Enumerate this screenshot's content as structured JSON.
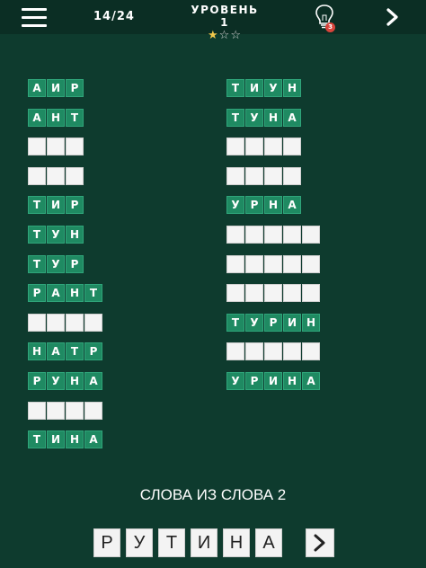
{
  "header": {
    "progress": "14/24",
    "level_label": "УРОВЕНЬ 1",
    "stars_filled": 1,
    "stars_total": 3,
    "hint_count": "3"
  },
  "colors": {
    "background": "#0e3b2e",
    "tile_solved": "#1f8a62",
    "tile_empty": "#f4f4f4",
    "star": "#f2c84b",
    "badge": "#d9443b"
  },
  "words": {
    "left": [
      {
        "letters": [
          "А",
          "И",
          "Р"
        ],
        "solved": true
      },
      {
        "letters": [
          "А",
          "Н",
          "Т"
        ],
        "solved": true
      },
      {
        "letters": [
          "",
          "",
          ""
        ],
        "solved": false
      },
      {
        "letters": [
          "",
          "",
          ""
        ],
        "solved": false
      },
      {
        "letters": [
          "Т",
          "И",
          "Р"
        ],
        "solved": true
      },
      {
        "letters": [
          "Т",
          "У",
          "Н"
        ],
        "solved": true
      },
      {
        "letters": [
          "Т",
          "У",
          "Р"
        ],
        "solved": true
      },
      {
        "letters": [
          "Р",
          "А",
          "Н",
          "Т"
        ],
        "solved": true
      },
      {
        "letters": [
          "",
          "",
          "",
          ""
        ],
        "solved": false
      },
      {
        "letters": [
          "Н",
          "А",
          "Т",
          "Р"
        ],
        "solved": true
      },
      {
        "letters": [
          "Р",
          "У",
          "Н",
          "А"
        ],
        "solved": true
      },
      {
        "letters": [
          "",
          "",
          "",
          ""
        ],
        "solved": false
      },
      {
        "letters": [
          "Т",
          "И",
          "Н",
          "А"
        ],
        "solved": true
      }
    ],
    "right": [
      {
        "letters": [
          "Т",
          "И",
          "У",
          "Н"
        ],
        "solved": true
      },
      {
        "letters": [
          "Т",
          "У",
          "Н",
          "А"
        ],
        "solved": true
      },
      {
        "letters": [
          "",
          "",
          "",
          ""
        ],
        "solved": false
      },
      {
        "letters": [
          "",
          "",
          "",
          ""
        ],
        "solved": false
      },
      {
        "letters": [
          "У",
          "Р",
          "Н",
          "А"
        ],
        "solved": true
      },
      {
        "letters": [
          "",
          "",
          "",
          "",
          ""
        ],
        "solved": false
      },
      {
        "letters": [
          "",
          "",
          "",
          "",
          ""
        ],
        "solved": false
      },
      {
        "letters": [
          "",
          "",
          "",
          "",
          ""
        ],
        "solved": false
      },
      {
        "letters": [
          "Т",
          "У",
          "Р",
          "И",
          "Н"
        ],
        "solved": true
      },
      {
        "letters": [
          "",
          "",
          "",
          "",
          ""
        ],
        "solved": false
      },
      {
        "letters": [
          "У",
          "Р",
          "И",
          "Н",
          "А"
        ],
        "solved": true
      }
    ]
  },
  "source": {
    "title": "СЛОВА ИЗ СЛОВА 2",
    "letters": [
      "Р",
      "У",
      "Т",
      "И",
      "Н",
      "А"
    ]
  },
  "icons": {
    "menu": "hamburger-icon",
    "hint": "lightbulb-icon",
    "next": "chevron-right-icon"
  }
}
